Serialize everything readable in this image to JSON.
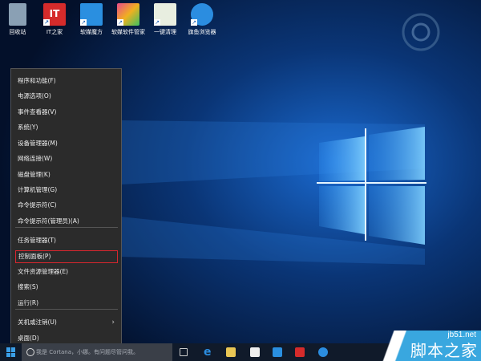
{
  "desktop": {
    "icons": [
      {
        "label": "回收站",
        "color": "#8aa0b4",
        "icon": "recycle-bin-icon"
      },
      {
        "label": "IT之家",
        "color": "#d52b2b",
        "glyph": "IT",
        "icon": "ithome-icon"
      },
      {
        "label": "软媒魔方",
        "color": "#2a8fe0",
        "icon": "ruanmei-cube-icon"
      },
      {
        "label": "软媒软件管家",
        "color": "#f0b020",
        "icon": "software-manager-icon"
      },
      {
        "label": "一键清理",
        "color": "#e8eee0",
        "icon": "cleanup-icon"
      },
      {
        "label": "旗鱼浏览器",
        "color": "#2b8de0",
        "icon": "browser-icon"
      }
    ]
  },
  "menu": {
    "group1": [
      "程序和功能(F)",
      "电源选项(O)",
      "事件查看器(V)",
      "系统(Y)",
      "设备管理器(M)",
      "网络连接(W)",
      "磁盘管理(K)",
      "计算机管理(G)",
      "命令提示符(C)",
      "命令提示符(管理员)(A)"
    ],
    "group2": [
      "任务管理器(T)",
      "控制面板(P)",
      "文件资源管理器(E)",
      "搜索(S)",
      "运行(R)"
    ],
    "group3": [
      "关机或注销(U)",
      "桌面(D)"
    ],
    "highlighted": "控制面板(P)"
  },
  "taskbar": {
    "search_placeholder": "我是 Cortana，小娜。有问题尽管问我。"
  },
  "watermark": {
    "site": "jb51.net",
    "logo": "脚本之家"
  }
}
